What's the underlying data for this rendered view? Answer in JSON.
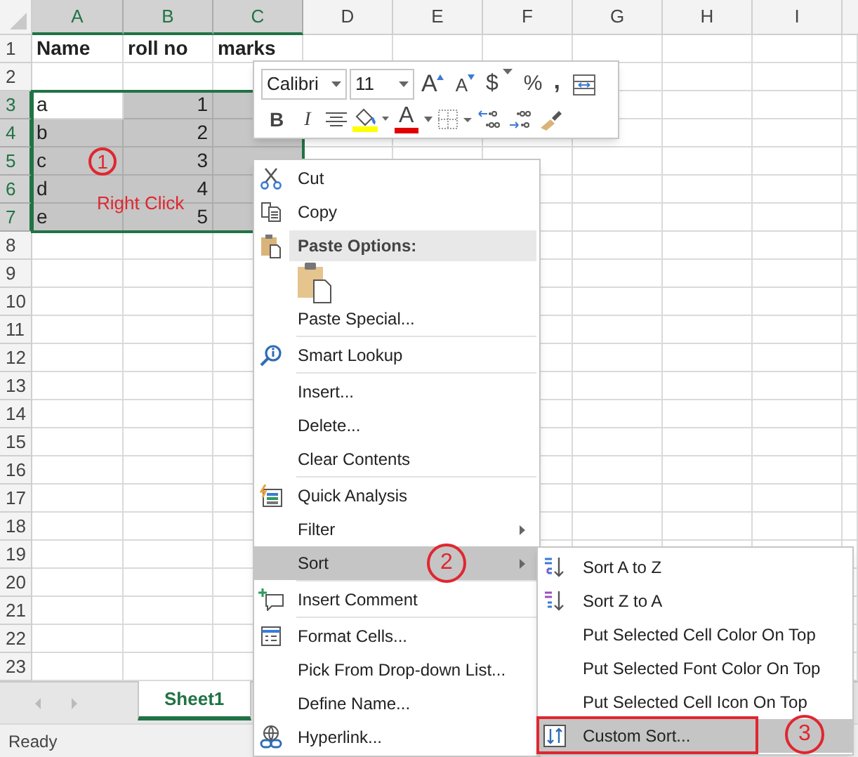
{
  "columns": [
    {
      "label": "A",
      "selected": true
    },
    {
      "label": "B",
      "selected": true
    },
    {
      "label": "C",
      "selected": true
    },
    {
      "label": "D",
      "selected": false
    },
    {
      "label": "E",
      "selected": false
    },
    {
      "label": "F",
      "selected": false
    },
    {
      "label": "G",
      "selected": false
    },
    {
      "label": "H",
      "selected": false
    },
    {
      "label": "I",
      "selected": false
    }
  ],
  "rows": [
    {
      "label": "1",
      "selected": false,
      "cells": [
        {
          "text": "Name",
          "kind": "text",
          "selected": false,
          "active": false,
          "bold": true
        },
        {
          "text": "roll no",
          "kind": "text",
          "selected": false,
          "active": false,
          "bold": true
        },
        {
          "text": "marks",
          "kind": "text",
          "selected": false,
          "active": false,
          "bold": true
        }
      ]
    },
    {
      "label": "2",
      "selected": false
    },
    {
      "label": "3",
      "selected": true,
      "cells": [
        {
          "text": "a",
          "kind": "text",
          "selected": true,
          "active": true
        },
        {
          "text": "1",
          "kind": "number",
          "selected": true,
          "active": false
        },
        {
          "kind": "empty",
          "selected": true,
          "active": false
        }
      ]
    },
    {
      "label": "4",
      "selected": true,
      "cells": [
        {
          "text": "b",
          "kind": "text",
          "selected": true,
          "active": false
        },
        {
          "text": "2",
          "kind": "number",
          "selected": true,
          "active": false
        },
        {
          "kind": "empty",
          "selected": true,
          "active": false
        }
      ]
    },
    {
      "label": "5",
      "selected": true,
      "cells": [
        {
          "text": "c",
          "kind": "text",
          "selected": true,
          "active": false
        },
        {
          "text": "3",
          "kind": "number",
          "selected": true,
          "active": false
        },
        {
          "kind": "empty",
          "selected": true,
          "active": false
        }
      ]
    },
    {
      "label": "6",
      "selected": true,
      "cells": [
        {
          "text": "d",
          "kind": "text",
          "selected": true,
          "active": false
        },
        {
          "text": "4",
          "kind": "number",
          "selected": true,
          "active": false
        },
        {
          "kind": "empty",
          "selected": true,
          "active": false
        }
      ]
    },
    {
      "label": "7",
      "selected": true,
      "cells": [
        {
          "text": "e",
          "kind": "text",
          "selected": true,
          "active": false
        },
        {
          "text": "5",
          "kind": "number",
          "selected": true,
          "active": false
        },
        {
          "kind": "empty",
          "selected": true,
          "active": false
        }
      ]
    },
    {
      "label": "8",
      "selected": false
    },
    {
      "label": "9",
      "selected": false
    },
    {
      "label": "10",
      "selected": false
    },
    {
      "label": "11",
      "selected": false
    },
    {
      "label": "12",
      "selected": false
    },
    {
      "label": "13",
      "selected": false
    },
    {
      "label": "14",
      "selected": false
    },
    {
      "label": "15",
      "selected": false
    },
    {
      "label": "16",
      "selected": false
    },
    {
      "label": "17",
      "selected": false
    },
    {
      "label": "18",
      "selected": false
    },
    {
      "label": "19",
      "selected": false
    },
    {
      "label": "20",
      "selected": false
    },
    {
      "label": "21",
      "selected": false
    },
    {
      "label": "22",
      "selected": false
    },
    {
      "label": "23",
      "selected": false
    }
  ],
  "mini_toolbar": {
    "font": "Calibri",
    "size": "11",
    "grow": "A",
    "shrink": "A",
    "currency": "$",
    "percent": "%",
    "comma": ",",
    "bold": "B",
    "italic": "I",
    "font_color": "A"
  },
  "context_menu": {
    "items": [
      {
        "kind": "item",
        "label": "Cut",
        "submenu": false,
        "selected": false,
        "divider": false
      },
      {
        "kind": "item",
        "label": "Copy",
        "submenu": false,
        "selected": false,
        "divider": false
      },
      {
        "kind": "section",
        "label": "Paste Options:",
        "selected": false,
        "divider": false
      },
      {
        "kind": "paste-icons",
        "selected": false,
        "divider": false
      },
      {
        "kind": "item",
        "label": "Paste Special...",
        "submenu": false,
        "selected": false,
        "divider": true
      },
      {
        "kind": "item",
        "label": "Smart Lookup",
        "submenu": false,
        "selected": false,
        "divider": true
      },
      {
        "kind": "item",
        "label": "Insert...",
        "submenu": false,
        "selected": false,
        "divider": false
      },
      {
        "kind": "item",
        "label": "Delete...",
        "submenu": false,
        "selected": false,
        "divider": false
      },
      {
        "kind": "item",
        "label": "Clear Contents",
        "submenu": false,
        "selected": false,
        "divider": true
      },
      {
        "kind": "item",
        "label": "Quick Analysis",
        "submenu": false,
        "selected": false,
        "divider": false
      },
      {
        "kind": "item",
        "label": "Filter",
        "submenu": true,
        "selected": false,
        "divider": false
      },
      {
        "kind": "item",
        "label": "Sort",
        "submenu": true,
        "selected": true,
        "divider": true
      },
      {
        "kind": "item",
        "label": "Insert Comment",
        "submenu": false,
        "selected": false,
        "divider": true
      },
      {
        "kind": "item",
        "label": "Format Cells...",
        "submenu": false,
        "selected": false,
        "divider": false
      },
      {
        "kind": "item",
        "label": "Pick From Drop-down List...",
        "submenu": false,
        "selected": false,
        "divider": false
      },
      {
        "kind": "item",
        "label": "Define Name...",
        "submenu": false,
        "selected": false,
        "divider": false
      },
      {
        "kind": "item",
        "label": "Hyperlink...",
        "submenu": false,
        "selected": false,
        "divider": false
      }
    ]
  },
  "sort_submenu": {
    "items": [
      {
        "label": "Sort A to Z",
        "selected": false
      },
      {
        "label": "Sort Z to A",
        "selected": false
      },
      {
        "label": "Put Selected Cell Color On Top",
        "selected": false
      },
      {
        "label": "Put Selected Font Color On Top",
        "selected": false
      },
      {
        "label": "Put Selected Cell Icon On Top",
        "selected": false
      },
      {
        "label": "Custom Sort...",
        "selected": true
      }
    ]
  },
  "annotations": [
    "1",
    "2",
    "3"
  ],
  "callout": "Right Click",
  "sheet_tabs": [
    {
      "label": "Sheet1",
      "selected": true
    }
  ],
  "status_bar": {
    "text": "Ready"
  }
}
